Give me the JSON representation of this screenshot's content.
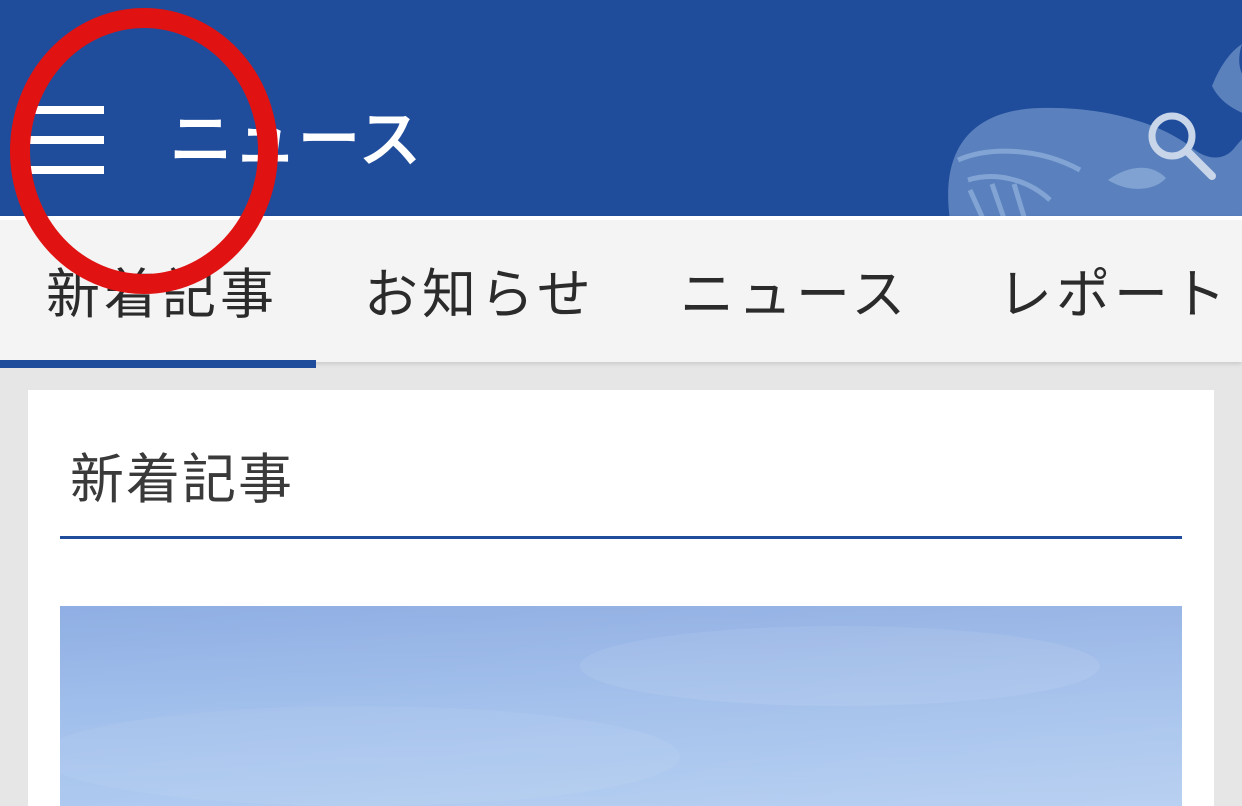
{
  "appbar": {
    "title": "ニュース",
    "background_color": "#1f4d9c",
    "menu_icon": "hamburger-menu-icon",
    "search_icon": "search-icon",
    "decoration": "whale-logo"
  },
  "tabs": [
    {
      "label": "新着記事",
      "selected": true
    },
    {
      "label": "お知らせ",
      "selected": false
    },
    {
      "label": "ニュース",
      "selected": false
    },
    {
      "label": "レポート",
      "selected": false
    }
  ],
  "section": {
    "title": "新着記事"
  },
  "colors": {
    "accent": "#1f4d9c",
    "highlight": "#e01212",
    "tab_bar_bg": "#f4f4f4",
    "page_bg": "#e6e6e6"
  }
}
